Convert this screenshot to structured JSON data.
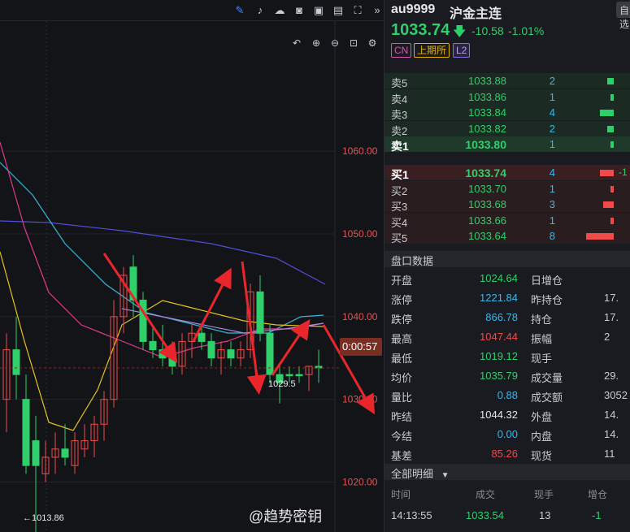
{
  "chart": {
    "y_axis_labels": [
      "1060.00",
      "1050.00",
      "1040.00",
      "1030.00",
      "1020.00"
    ],
    "countdown": "0:00:57",
    "low_marker": "←1013.86",
    "low_marker2": "1029.5",
    "watermark": "@趋势密钥"
  },
  "chart_data": {
    "type": "candlestick",
    "ylim": [
      1012,
      1072
    ],
    "candles": [
      {
        "o": 1030,
        "h": 1038,
        "l": 1026,
        "c": 1036,
        "d": "up"
      },
      {
        "o": 1036,
        "h": 1040,
        "l": 1030,
        "c": 1033,
        "d": "dn"
      },
      {
        "o": 1030,
        "h": 1033,
        "l": 1021,
        "c": 1022,
        "d": "dn"
      },
      {
        "o": 1022,
        "h": 1028,
        "l": 1013.86,
        "c": 1025,
        "d": "dn"
      },
      {
        "o": 1021,
        "h": 1025,
        "l": 1020,
        "c": 1023,
        "d": "up"
      },
      {
        "o": 1023,
        "h": 1026,
        "l": 1021,
        "c": 1024,
        "d": "up"
      },
      {
        "o": 1024,
        "h": 1027,
        "l": 1022,
        "c": 1023,
        "d": "dn"
      },
      {
        "o": 1022,
        "h": 1026,
        "l": 1021,
        "c": 1025,
        "d": "up"
      },
      {
        "o": 1025,
        "h": 1027,
        "l": 1023,
        "c": 1024,
        "d": "up"
      },
      {
        "o": 1025,
        "h": 1028,
        "l": 1023,
        "c": 1027,
        "d": "up"
      },
      {
        "o": 1027,
        "h": 1031,
        "l": 1025,
        "c": 1030,
        "d": "up"
      },
      {
        "o": 1030,
        "h": 1042,
        "l": 1029,
        "c": 1040,
        "d": "up"
      },
      {
        "o": 1040,
        "h": 1046,
        "l": 1038,
        "c": 1045,
        "d": "up"
      },
      {
        "o": 1046,
        "h": 1047.44,
        "l": 1040,
        "c": 1042,
        "d": "dn"
      },
      {
        "o": 1042,
        "h": 1043,
        "l": 1036,
        "c": 1037,
        "d": "dn"
      },
      {
        "o": 1037,
        "h": 1039,
        "l": 1035,
        "c": 1036,
        "d": "dn"
      },
      {
        "o": 1036,
        "h": 1039,
        "l": 1034,
        "c": 1035,
        "d": "dn"
      },
      {
        "o": 1035,
        "h": 1037,
        "l": 1033,
        "c": 1034,
        "d": "dn"
      },
      {
        "o": 1034,
        "h": 1038,
        "l": 1033,
        "c": 1037,
        "d": "up"
      },
      {
        "o": 1037,
        "h": 1039,
        "l": 1035,
        "c": 1038,
        "d": "up"
      },
      {
        "o": 1038,
        "h": 1039,
        "l": 1036,
        "c": 1037,
        "d": "dn"
      },
      {
        "o": 1037,
        "h": 1038,
        "l": 1034,
        "c": 1035,
        "d": "dn"
      },
      {
        "o": 1035,
        "h": 1037,
        "l": 1033,
        "c": 1036,
        "d": "up"
      },
      {
        "o": 1036,
        "h": 1037,
        "l": 1034,
        "c": 1035,
        "d": "dn"
      },
      {
        "o": 1035,
        "h": 1037,
        "l": 1034,
        "c": 1036,
        "d": "up"
      },
      {
        "o": 1036,
        "h": 1044,
        "l": 1035,
        "c": 1043,
        "d": "up"
      },
      {
        "o": 1043,
        "h": 1045,
        "l": 1037,
        "c": 1038,
        "d": "dn"
      },
      {
        "o": 1038,
        "h": 1039,
        "l": 1032,
        "c": 1033,
        "d": "dn"
      },
      {
        "o": 1033,
        "h": 1034,
        "l": 1029.5,
        "c": 1032,
        "d": "dn"
      },
      {
        "o": 1033,
        "h": 1034,
        "l": 1032,
        "c": 1033,
        "d": "dn"
      },
      {
        "o": 1033,
        "h": 1034,
        "l": 1032,
        "c": 1033,
        "d": "dn"
      },
      {
        "o": 1033,
        "h": 1034,
        "l": 1031,
        "c": 1034,
        "d": "up"
      },
      {
        "o": 1034,
        "h": 1036,
        "l": 1032,
        "c": 1033.8,
        "d": "dn"
      }
    ]
  },
  "quote": {
    "symbol": "au9999",
    "name": "沪金主连",
    "button": "自选",
    "price": "1033.74",
    "change": "-10.58",
    "change_pct": "-1.01%",
    "tags": [
      "CN",
      "上期所",
      "L2"
    ]
  },
  "orderbook": {
    "asks": [
      {
        "label": "卖5",
        "price": "1033.88",
        "vol": "2",
        "bar": 10
      },
      {
        "label": "卖4",
        "price": "1033.86",
        "vol": "1",
        "bar": 5
      },
      {
        "label": "卖3",
        "price": "1033.84",
        "vol": "4",
        "bar": 20
      },
      {
        "label": "卖2",
        "price": "1033.82",
        "vol": "2",
        "bar": 10
      },
      {
        "label": "卖1",
        "price": "1033.80",
        "vol": "1",
        "bar": 5
      }
    ],
    "bids": [
      {
        "label": "买1",
        "price": "1033.74",
        "vol": "4",
        "bar": 20,
        "chg": "-1"
      },
      {
        "label": "买2",
        "price": "1033.70",
        "vol": "1",
        "bar": 5
      },
      {
        "label": "买3",
        "price": "1033.68",
        "vol": "3",
        "bar": 15
      },
      {
        "label": "买4",
        "price": "1033.66",
        "vol": "1",
        "bar": 5
      },
      {
        "label": "买5",
        "price": "1033.64",
        "vol": "8",
        "bar": 40
      }
    ]
  },
  "stats": {
    "title": "盘口数据",
    "rows": [
      {
        "l1": "开盘",
        "v1": "1024.64",
        "c1": "#2fcf6b",
        "l2": "日增仓",
        "v2": ""
      },
      {
        "l1": "涨停",
        "v1": "1221.84",
        "c1": "#3ab7e6",
        "l2": "昨持仓",
        "v2": "17."
      },
      {
        "l1": "跌停",
        "v1": "866.78",
        "c1": "#3ab7e6",
        "l2": "持仓",
        "v2": "17."
      },
      {
        "l1": "最高",
        "v1": "1047.44",
        "c1": "#f04a4a",
        "l2": "振幅",
        "v2": "2"
      },
      {
        "l1": "最低",
        "v1": "1019.12",
        "c1": "#2fcf6b",
        "l2": "现手",
        "v2": ""
      },
      {
        "l1": "均价",
        "v1": "1035.79",
        "c1": "#2fcf6b",
        "l2": "成交量",
        "v2": "29."
      },
      {
        "l1": "量比",
        "v1": "0.88",
        "c1": "#3ab7e6",
        "l2": "成交额",
        "v2": "3052"
      },
      {
        "l1": "昨结",
        "v1": "1044.32",
        "c1": "#e6e6e6",
        "l2": "外盘",
        "v2": "14."
      },
      {
        "l1": "今结",
        "v1": "0.00",
        "c1": "#3ab7e6",
        "l2": "内盘",
        "v2": "14."
      },
      {
        "l1": "基差",
        "v1": "85.26",
        "c1": "#f04a4a",
        "l2": "现货",
        "v2": "11"
      }
    ]
  },
  "trades": {
    "title": "全部明细",
    "headers": [
      "时间",
      "成交",
      "现手",
      "增仓"
    ],
    "row": {
      "time": "14:13:55",
      "price": "1033.54",
      "vol": "13",
      "chg": "-1"
    }
  }
}
